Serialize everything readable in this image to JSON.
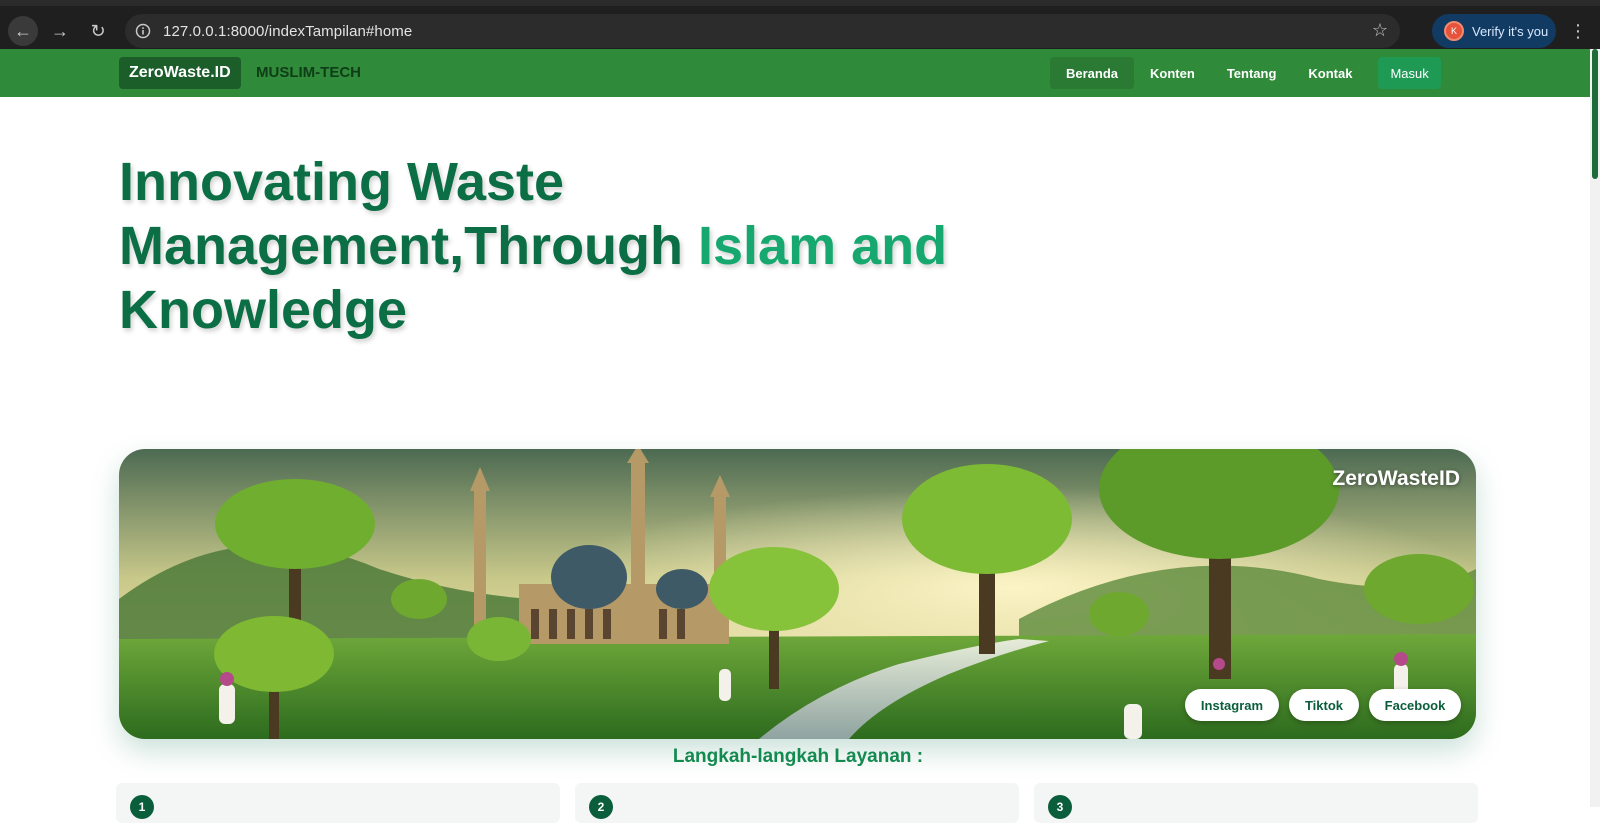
{
  "browser": {
    "url": "127.0.0.1:8000/indexTampilan#home",
    "profile_label": "Verify it's you",
    "profile_initial": "K"
  },
  "navbar": {
    "brand": "ZeroWaste.ID",
    "tagline": "MUSLIM-TECH",
    "items": [
      {
        "label": "Beranda"
      },
      {
        "label": "Konten"
      },
      {
        "label": "Tentang"
      },
      {
        "label": "Kontak"
      }
    ],
    "login_label": "Masuk"
  },
  "hero": {
    "line1": "Innovating Waste",
    "line2_part1": "Management,",
    "line2_part2": "Through Islam and",
    "line3": "Knowledge"
  },
  "banner": {
    "brand": "ZeroWasteID",
    "social": [
      "Instagram",
      "Tiktok",
      "Facebook"
    ]
  },
  "steps": {
    "title": "Langkah-langkah Layanan :",
    "numbers": [
      "1",
      "2",
      "3"
    ]
  },
  "colors": {
    "navbar": "#2f8a39",
    "heading": "#0b6e45",
    "heading_accent": "#17a870",
    "steps_title": "#138a4f"
  }
}
